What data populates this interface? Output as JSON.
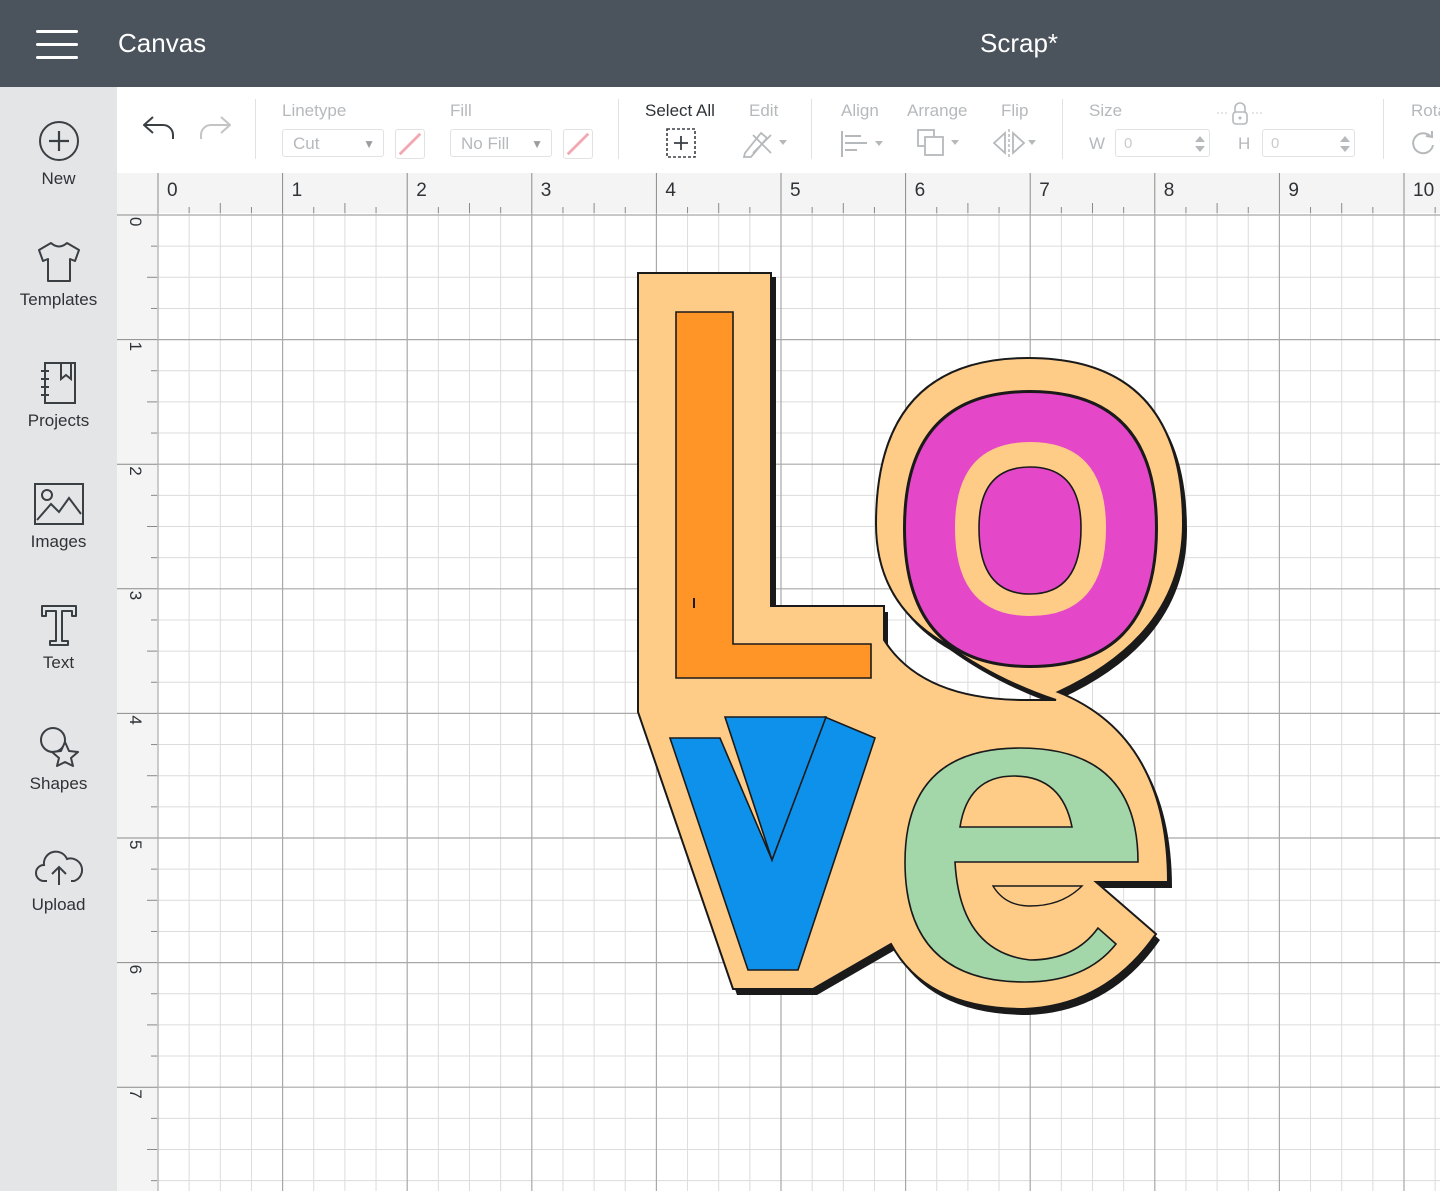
{
  "header": {
    "menu_icon": "hamburger-icon",
    "app_title": "Canvas",
    "document_title": "Scrap*"
  },
  "sidebar": {
    "items": [
      {
        "label": "New",
        "icon": "plus-circle-icon"
      },
      {
        "label": "Templates",
        "icon": "tshirt-icon"
      },
      {
        "label": "Projects",
        "icon": "book-icon"
      },
      {
        "label": "Images",
        "icon": "image-icon"
      },
      {
        "label": "Text",
        "icon": "text-t-icon"
      },
      {
        "label": "Shapes",
        "icon": "shapes-icon"
      },
      {
        "label": "Upload",
        "icon": "cloud-upload-icon"
      }
    ]
  },
  "toolbar": {
    "linetype_label": "Linetype",
    "linetype_value": "Cut",
    "fill_label": "Fill",
    "fill_value": "No Fill",
    "select_all_label": "Select All",
    "edit_label": "Edit",
    "align_label": "Align",
    "arrange_label": "Arrange",
    "flip_label": "Flip",
    "size_label": "Size",
    "width_label": "W",
    "width_value": "0",
    "height_label": "H",
    "height_value": "0",
    "rotate_label": "Rotate"
  },
  "ruler": {
    "x_ticks": [
      "0",
      "1",
      "2",
      "3",
      "4",
      "5",
      "6",
      "7",
      "8",
      "9",
      "10"
    ],
    "y_ticks": [
      "0",
      "1",
      "2",
      "3",
      "4",
      "5",
      "6",
      "7"
    ]
  },
  "colors": {
    "header_bg": "#4b545c",
    "sidebar_bg": "#e4e5e7",
    "backing": "#ffcc88",
    "letter_l": "#fe9526",
    "letter_o": "#e447c8",
    "letter_v": "#0e91ea",
    "letter_e": "#a3d6a9"
  }
}
